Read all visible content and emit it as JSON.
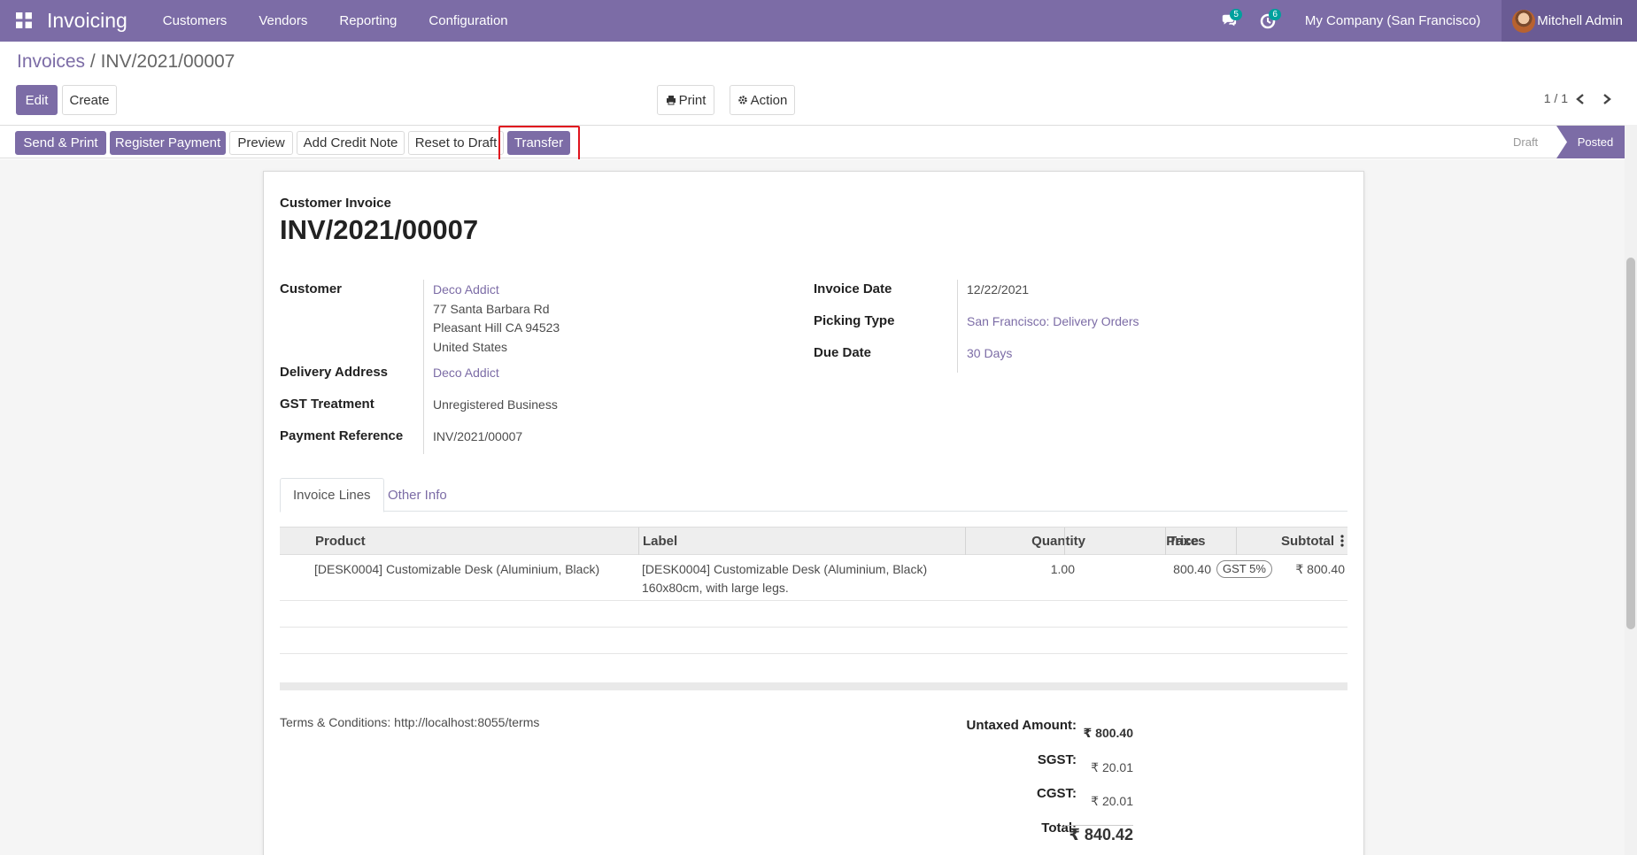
{
  "navbar": {
    "app_name": "Invoicing",
    "menu": [
      "Customers",
      "Vendors",
      "Reporting",
      "Configuration"
    ],
    "messages_count": "5",
    "activities_count": "6",
    "company": "My Company (San Francisco)",
    "user": "Mitchell Admin",
    "color": "#7c6ca6"
  },
  "breadcrumb": {
    "parent": "Invoices",
    "separator": " / ",
    "current": "INV/2021/00007"
  },
  "toolbar": {
    "edit": "Edit",
    "create": "Create",
    "print": "Print",
    "action": "Action",
    "pager": "1 / 1"
  },
  "statusbar": {
    "buttons": [
      "Send & Print",
      "Register Payment",
      "Preview",
      "Add Credit Note",
      "Reset to Draft",
      "Transfer"
    ],
    "stages": [
      "Draft",
      "Posted"
    ],
    "active_stage": "Posted"
  },
  "invoice": {
    "type": "Customer Invoice",
    "name": "INV/2021/00007",
    "labels": {
      "customer": "Customer",
      "delivery_address": "Delivery Address",
      "gst_treatment": "GST Treatment",
      "payment_reference": "Payment Reference",
      "invoice_date": "Invoice Date",
      "picking_type": "Picking Type",
      "due_date": "Due Date"
    },
    "customer": {
      "name": "Deco Addict",
      "address_line1": "77 Santa Barbara Rd",
      "address_line2": "Pleasant Hill CA 94523",
      "country": "United States"
    },
    "delivery_address": "Deco Addict",
    "gst_treatment": "Unregistered Business",
    "payment_reference": "INV/2021/00007",
    "invoice_date": "12/22/2021",
    "picking_type": "San Francisco: Delivery Orders",
    "due_date": "30 Days"
  },
  "tabs": [
    "Invoice Lines",
    "Other Info"
  ],
  "lines_table": {
    "headers": [
      "Product",
      "Label",
      "Quantity",
      "Price",
      "Taxes",
      "Subtotal"
    ],
    "rows": [
      {
        "product": "[DESK0004] Customizable Desk (Aluminium, Black)",
        "label_line1": "[DESK0004] Customizable Desk (Aluminium, Black)",
        "label_line2": "160x80cm, with large legs.",
        "quantity": "1.00",
        "price": "800.40",
        "taxes": "GST 5%",
        "subtotal": "₹ 800.40"
      }
    ]
  },
  "terms": "Terms & Conditions: http://localhost:8055/terms",
  "totals": {
    "untaxed_label": "Untaxed Amount:",
    "untaxed": "₹ 800.40",
    "sgst_label": "SGST:",
    "sgst": "₹ 20.01",
    "cgst_label": "CGST:",
    "cgst": "₹ 20.01",
    "total_label": "Total:",
    "total": "₹ 840.42"
  }
}
